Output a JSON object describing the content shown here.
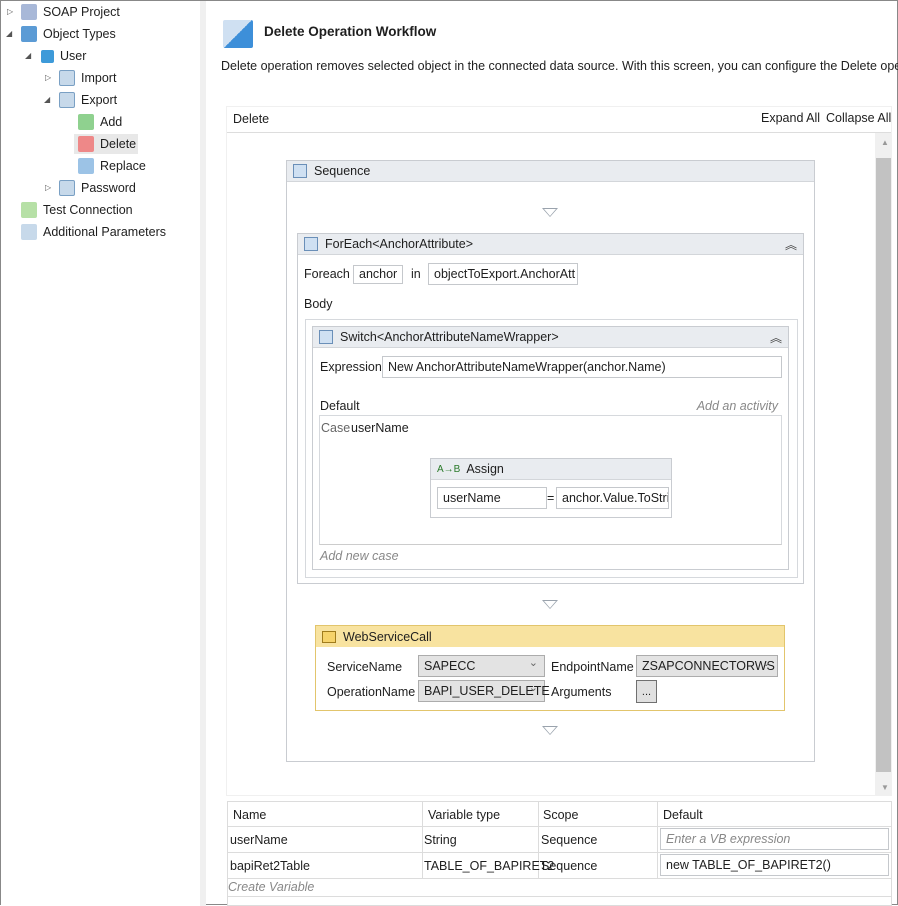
{
  "tree": {
    "items": [
      {
        "label": "SOAP Project",
        "icon": "soap-project-icon"
      },
      {
        "label": "Object Types",
        "icon": "object-types-icon"
      },
      {
        "label": "User",
        "icon": "user-type-icon"
      },
      {
        "label": "Import",
        "icon": "import-icon"
      },
      {
        "label": "Export",
        "icon": "export-icon"
      },
      {
        "label": "Add",
        "icon": "add-workflow-icon"
      },
      {
        "label": "Delete",
        "icon": "delete-workflow-icon"
      },
      {
        "label": "Replace",
        "icon": "replace-workflow-icon"
      },
      {
        "label": "Password",
        "icon": "password-icon"
      },
      {
        "label": "Test Connection",
        "icon": "test-connection-icon"
      },
      {
        "label": "Additional Parameters",
        "icon": "additional-parameters-icon"
      }
    ]
  },
  "header": {
    "title": "Delete Operation Workflow",
    "description": "Delete operation removes selected object in the connected data source. With this screen, you can configure the Delete operation"
  },
  "designer": {
    "breadcrumb": "Delete",
    "expand_all": "Expand All",
    "collapse_all": "Collapse All",
    "sequence": {
      "title": "Sequence"
    },
    "foreach": {
      "title": "ForEach<AnchorAttribute>",
      "foreach_label": "Foreach",
      "item": "anchor",
      "in_label": "in",
      "values": "objectToExport.AnchorAtt",
      "body_label": "Body"
    },
    "switch": {
      "title": "Switch<AnchorAttributeNameWrapper>",
      "expression_label": "Expression",
      "expression": "New AnchorAttributeNameWrapper(anchor.Name)",
      "default_label": "Default",
      "add_activity": "Add an activity",
      "case_label": "Case",
      "case_value": "userName",
      "add_case": "Add new case"
    },
    "assign": {
      "title": "Assign",
      "to": "userName",
      "eq": "=",
      "value": "anchor.Value.ToStri"
    },
    "webservice": {
      "title": "WebServiceCall",
      "service_label": "ServiceName",
      "service": "SAPECC",
      "endpoint_label": "EndpointName",
      "endpoint": "ZSAPCONNECTORWS",
      "operation_label": "OperationName",
      "operation": "BAPI_USER_DELETE",
      "arguments_label": "Arguments",
      "arguments_button": "..."
    }
  },
  "variables": {
    "columns": [
      "Name",
      "Variable type",
      "Scope",
      "Default"
    ],
    "rows": [
      {
        "name": "userName",
        "type": "String",
        "scope": "Sequence",
        "default": "",
        "placeholder": "Enter a VB expression"
      },
      {
        "name": "bapiRet2Table",
        "type": "TABLE_OF_BAPIRET2",
        "scope": "Sequence",
        "default": "new TABLE_OF_BAPIRET2()"
      }
    ],
    "create": "Create Variable"
  },
  "colors": {
    "accent_yellow": "#f8e3a0",
    "header_gray": "#e9ecf0"
  }
}
